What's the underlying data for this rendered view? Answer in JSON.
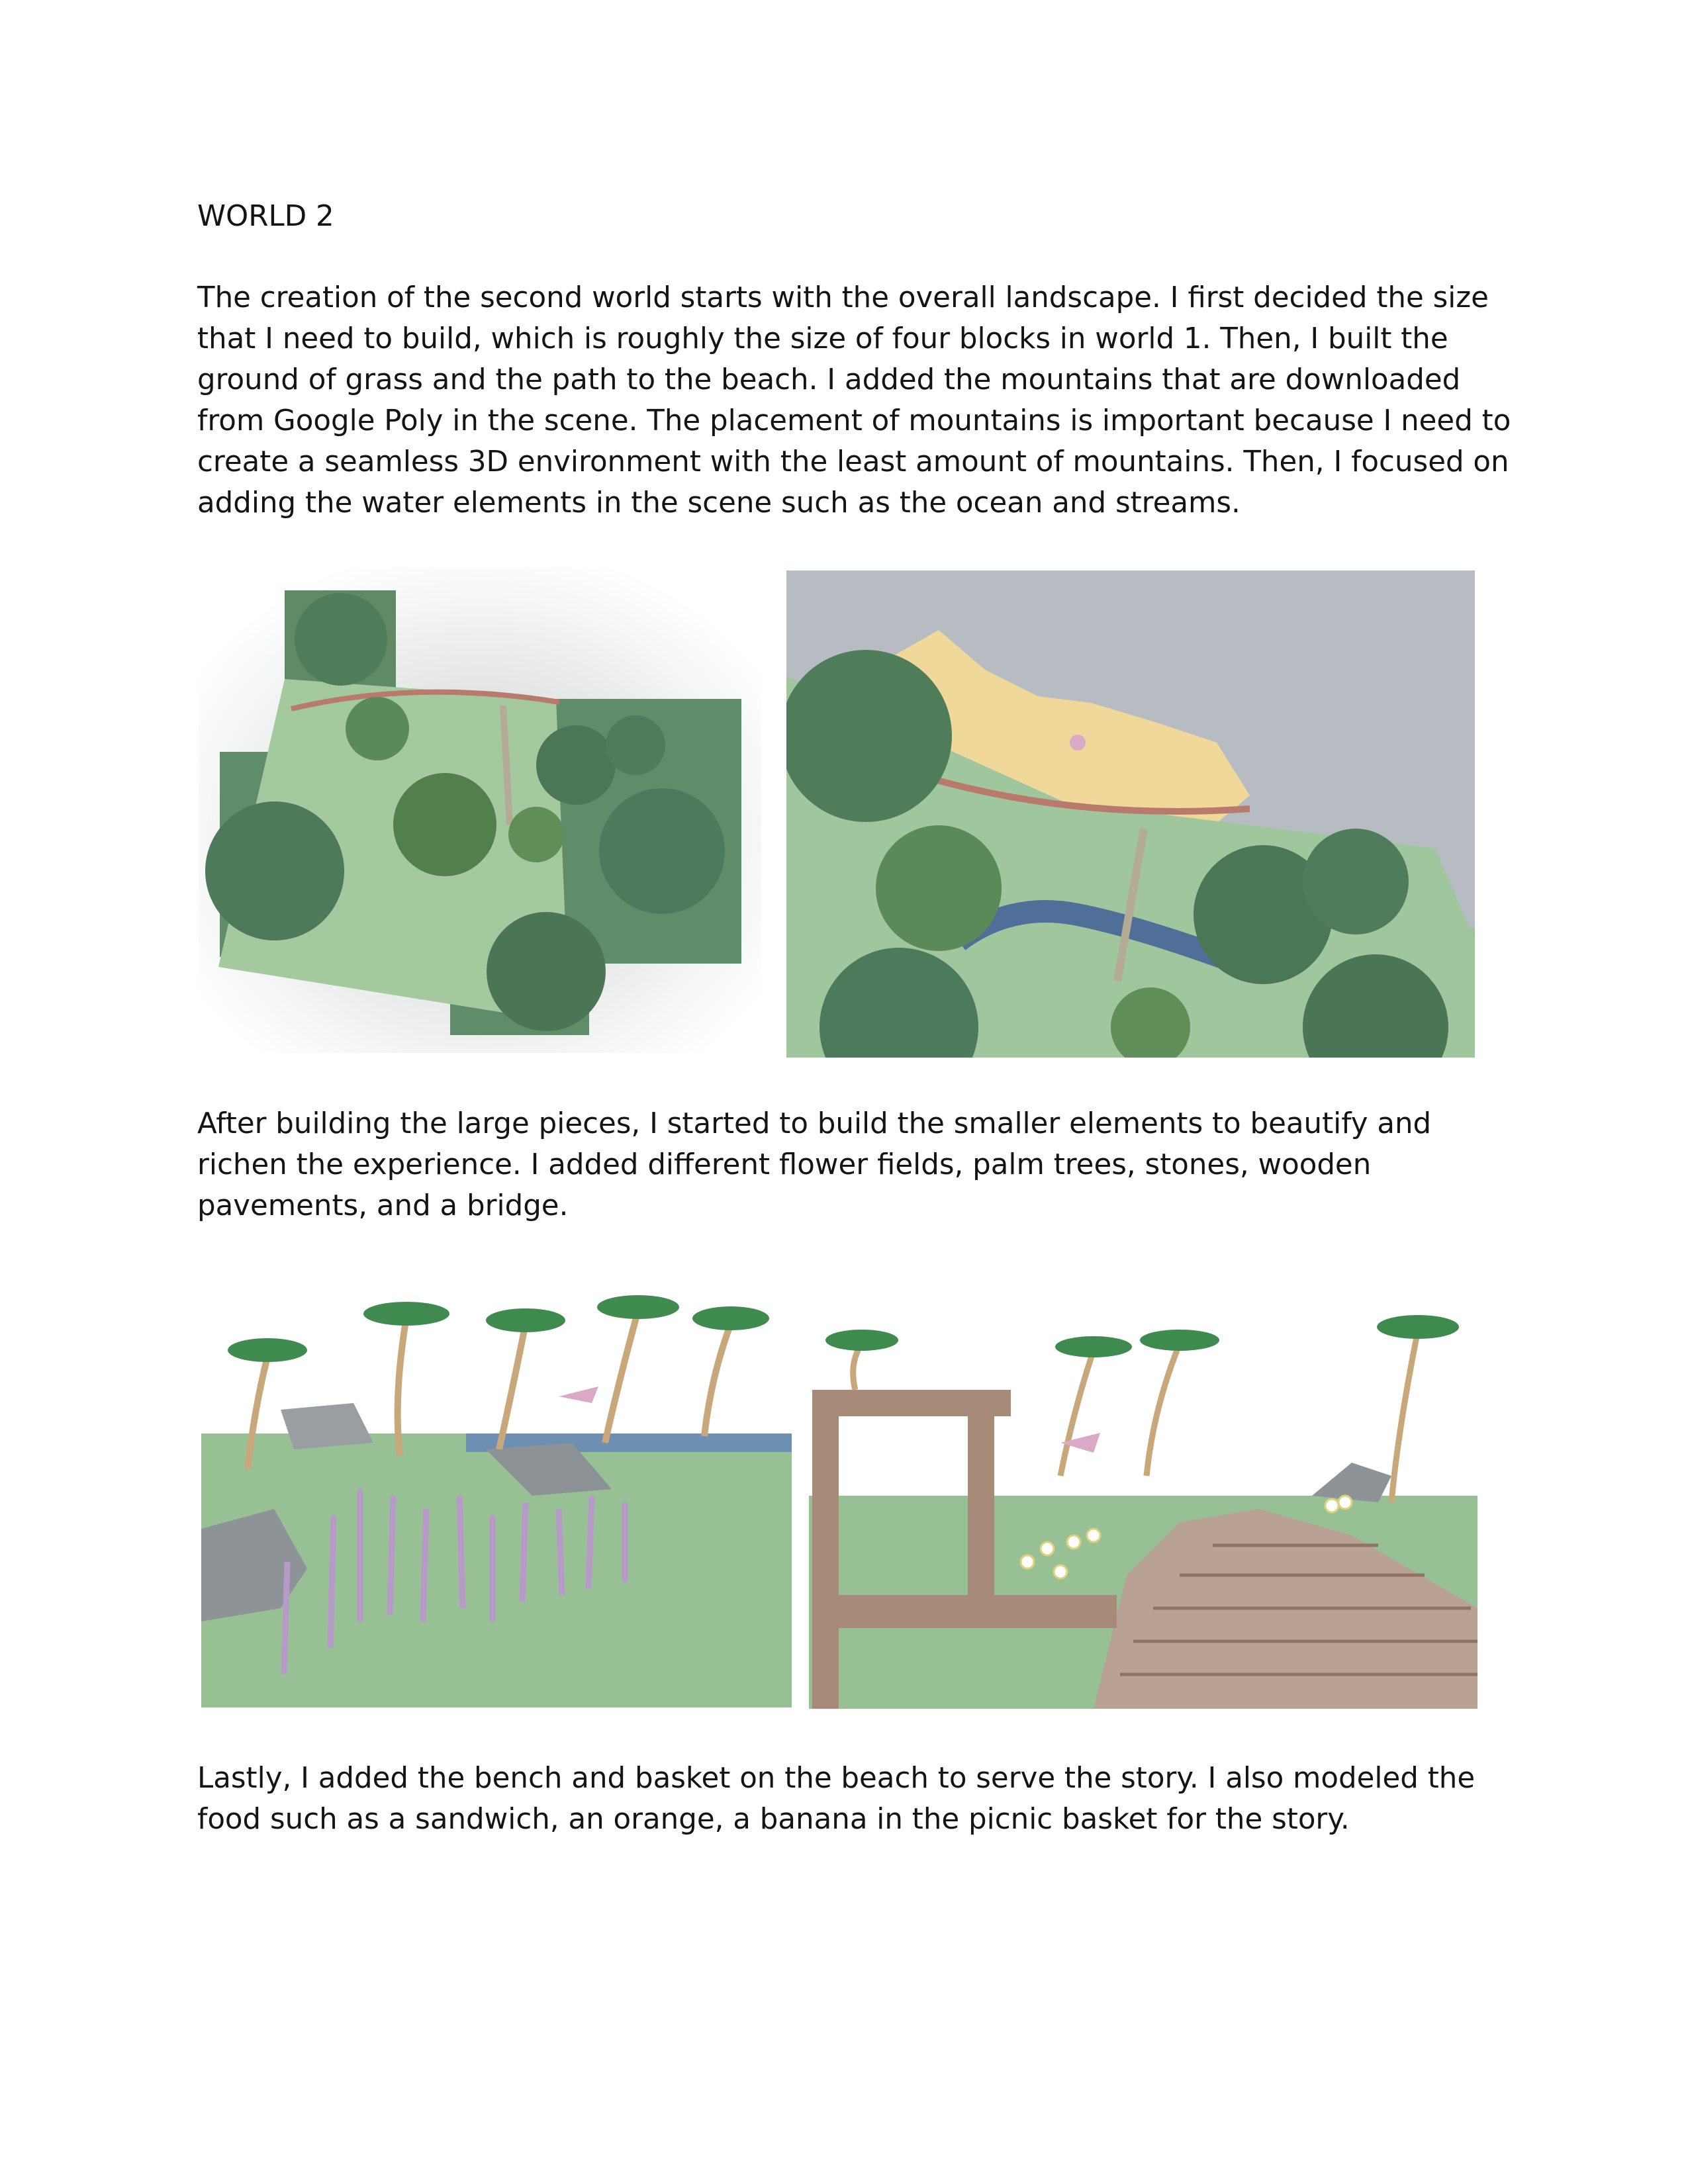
{
  "document": {
    "heading": "WORLD 2",
    "paragraph_1": [
      "The creation of the second world starts with the overall landscape. I first decided the size",
      "that I need to build, which is roughly the size of four blocks in world 1. Then, I built the",
      "ground of grass and the path to the beach. I added the mountains that are downloaded",
      "from Google Poly in the scene. The placement of mountains is important because I need to",
      "create a seamless 3D environment with the least amount of mountains. Then, I focused on",
      "adding the water elements in the scene such as the ocean and streams."
    ],
    "paragraph_2": [
      "After building the large pieces, I started to build the smaller elements to beautify and",
      "richen the experience. I added different flower fields, palm trees, stones, wooden",
      "pavements, and a bridge."
    ],
    "paragraph_3": [
      "Lastly, I added the bench and basket on the beach to serve the story. I also modeled the",
      "food such as a sandwich, an orange, a banana in the picnic basket for the story."
    ]
  },
  "figures": [
    {
      "id": "top-left",
      "subject": "aerial view of terrain blocks with trees"
    },
    {
      "id": "top-right",
      "subject": "aerial view of beach, mountains, stream and bridge"
    },
    {
      "id": "bottom-left",
      "subject": "purple flower field with palm trees and stones"
    },
    {
      "id": "bottom-right",
      "subject": "wooden gate, pavement path, daisies and palm trees"
    }
  ],
  "colors": {
    "grass": "#9cc39a",
    "tree": "#4f7d5c",
    "sand": "#efd89a",
    "rock": "#b9bec4",
    "water": "#4f6e98",
    "wood": "#a88a78",
    "lavender": "#b79ac8"
  }
}
